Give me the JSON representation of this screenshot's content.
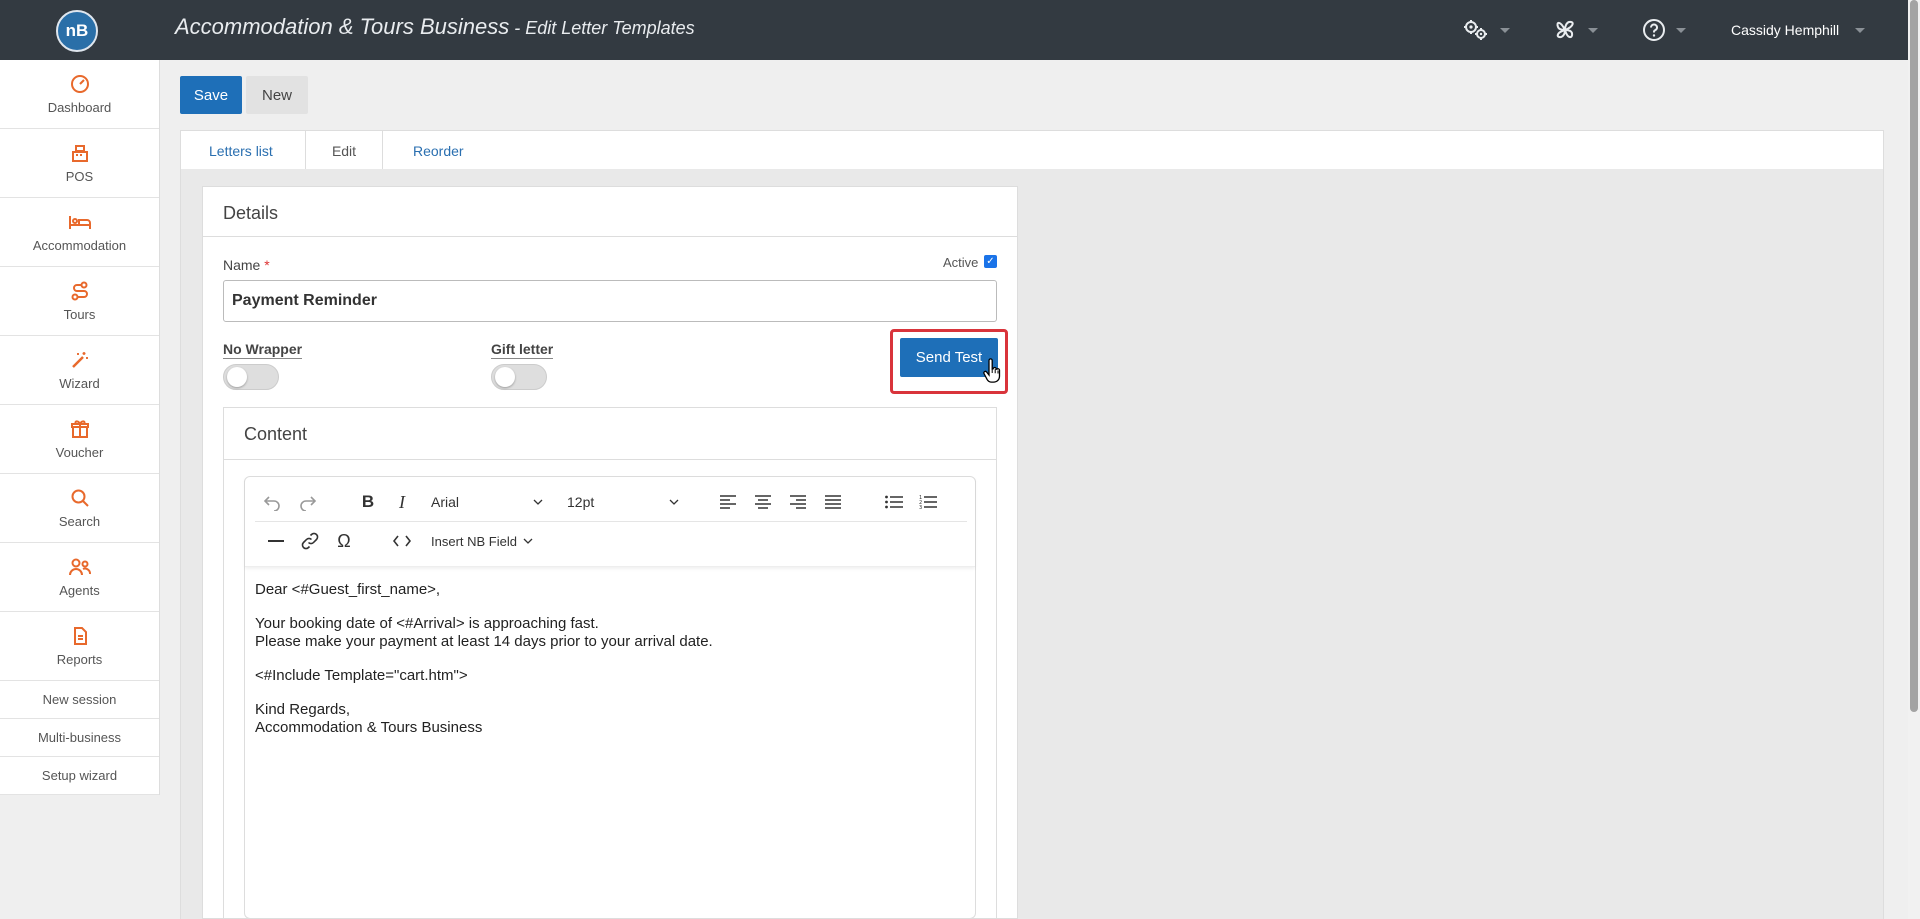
{
  "app": {
    "logo_text": "nB",
    "title_main": "Accommodation & Tours Business",
    "title_sub": " - Edit Letter Templates",
    "user_name": "Cassidy Hemphill"
  },
  "top_icons": [
    "settings-gears-icon",
    "fan-icon",
    "help-icon"
  ],
  "sidebar": {
    "items": [
      {
        "label": "Dashboard",
        "icon": "dashboard-gauge-icon"
      },
      {
        "label": "POS",
        "icon": "cash-register-icon"
      },
      {
        "label": "Accommodation",
        "icon": "bed-icon"
      },
      {
        "label": "Tours",
        "icon": "route-icon"
      },
      {
        "label": "Wizard",
        "icon": "magic-wand-icon"
      },
      {
        "label": "Voucher",
        "icon": "gift-icon"
      },
      {
        "label": "Search",
        "icon": "search-icon"
      },
      {
        "label": "Agents",
        "icon": "agents-icon"
      },
      {
        "label": "Reports",
        "icon": "report-document-icon"
      }
    ],
    "links": [
      {
        "label": "New session"
      },
      {
        "label": "Multi-business"
      },
      {
        "label": "Setup wizard"
      }
    ],
    "accent": "#e8692c"
  },
  "actions": {
    "save": "Save",
    "new": "New"
  },
  "tabs": [
    {
      "label": "Letters list"
    },
    {
      "label": "Edit"
    },
    {
      "label": "Reorder"
    }
  ],
  "details": {
    "heading": "Details",
    "name_label": "Name",
    "required_mark": "*",
    "name_value": "Payment Reminder",
    "active_label": "Active",
    "active_checked": true,
    "no_wrapper_label": "No Wrapper",
    "no_wrapper_on": false,
    "gift_letter_label": "Gift letter",
    "gift_letter_on": false,
    "send_test": "Send Test"
  },
  "content": {
    "heading": "Content",
    "font_family": "Arial",
    "font_size": "12pt",
    "insert_field": "Insert NB Field",
    "body": {
      "greeting": "Dear <#Guest_first_name>,",
      "line1": "Your booking date of <#Arrival> is approaching fast.",
      "line2": "Please make your payment at least 14 days prior to your arrival date.",
      "include": "<#Include Template=\"cart.htm\">",
      "closing": "Kind Regards,",
      "signature": "Accommodation & Tours Business"
    }
  },
  "colors": {
    "topbar": "#333a41",
    "primary": "#1e6fb8",
    "highlight": "#d9343b"
  }
}
